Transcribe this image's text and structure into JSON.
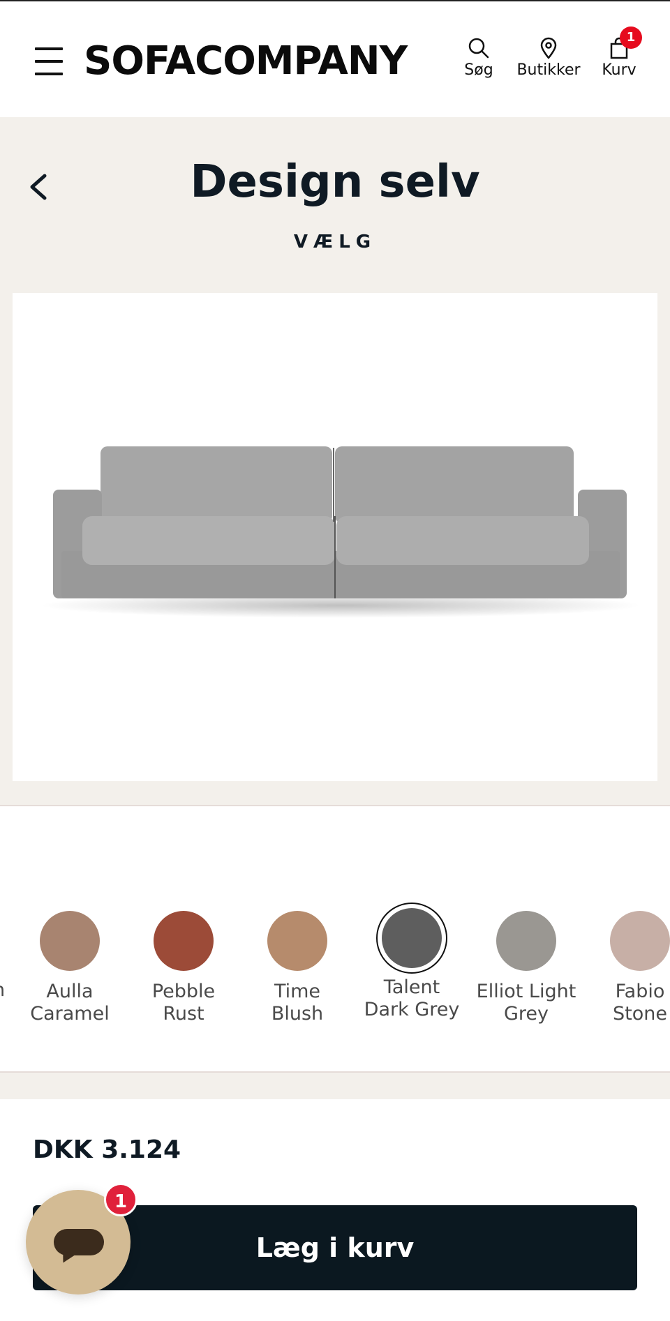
{
  "header": {
    "logo": "SOFACOMPANY",
    "search_label": "Søg",
    "stores_label": "Butikker",
    "cart_label": "Kurv",
    "cart_count": "1"
  },
  "design": {
    "title": "Design selv",
    "subtitle": "VÆLG"
  },
  "swatches": {
    "partial_left_label": "n",
    "items": [
      {
        "line1": "Aulla",
        "line2": "Caramel",
        "color": "#a88470"
      },
      {
        "line1": "Pebble",
        "line2": "Rust",
        "color": "#9c4b38"
      },
      {
        "line1": "Time",
        "line2": "Blush",
        "color": "#b68b6c"
      },
      {
        "line1": "Talent",
        "line2": "Dark Grey",
        "color": "#5e5e5e",
        "selected": true
      },
      {
        "line1": "Elliot Light",
        "line2": "Grey",
        "color": "#9a9792"
      },
      {
        "line1": "Fabio",
        "line2": "Stone",
        "color": "#c7afa6"
      }
    ]
  },
  "purchase": {
    "price": "DKK 3.124",
    "add_to_cart": "Læg i kurv"
  },
  "chat": {
    "badge": "1"
  },
  "colors": {
    "dark_navy": "#0b1820",
    "beige_bg": "#f3f0eb",
    "badge_red": "#e60b1e",
    "chat_bg": "#d3bb94"
  }
}
